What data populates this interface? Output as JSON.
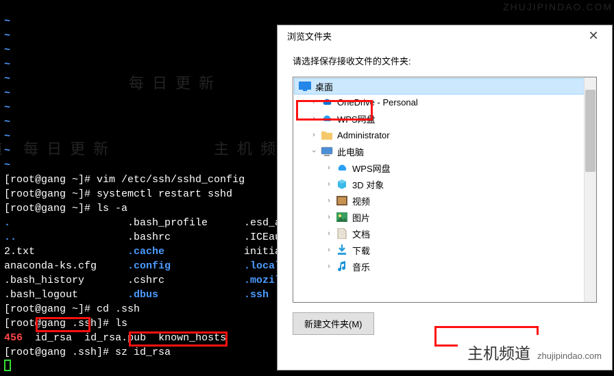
{
  "terminal": {
    "tilde": "~",
    "l1_a": "[root@gang ~]# ",
    "l1_b": "vim /etc/ssh/sshd_config",
    "l2_a": "[root@gang ~]# ",
    "l2_b": "systemctl restart sshd",
    "l3_a": "[root@gang ~]# ",
    "l3_b": "ls -a",
    "row1": {
      "c1": ".",
      "c2": ".bash_profile",
      "c3": ".esd_auth"
    },
    "row2": {
      "c1": "..",
      "c2": ".bashrc",
      "c3": ".ICEauthority"
    },
    "row3": {
      "c1": "2.txt",
      "c2": ".cache",
      "c3": "initial-setup-ks.cfg"
    },
    "row4": {
      "c1": "anaconda-ks.cfg",
      "c2": ".config",
      "c3": ".local"
    },
    "row5": {
      "c1": ".bash_history",
      "c2": ".cshrc",
      "c3": ".mozilla"
    },
    "row6": {
      "c1": ".bash_logout",
      "c2": ".dbus",
      "c3": ".ssh"
    },
    "l4_a": "[root@gang ~]# ",
    "l4_b": "cd .ssh",
    "l5_a": "[root@gang .ssh]# ",
    "l5_b": "ls",
    "lsrow": {
      "a": "456",
      "b": "id_rsa",
      "c": "id_rsa.pub",
      "d": "known_hosts"
    },
    "l6_a": "[root@gang .ssh]# ",
    "l6_b": "sz id_rsa"
  },
  "watermarks": {
    "cn1": "每日更新",
    "cn2": "主机频道 每日更新",
    "cn3": "主机频道",
    "en1": "ZHUJIPINDAO.COM",
    "en2": "ZHUJIPIND"
  },
  "dialog": {
    "title": "浏览文件夹",
    "message": "请选择保存接收文件的文件夹:",
    "tree": {
      "desktop": "桌面",
      "onedrive": "OneDrive - Personal",
      "wps": "WPS网盘",
      "admin": "Administrator",
      "thispc": "此电脑",
      "wps2": "WPS网盘",
      "threeD": "3D 对象",
      "video": "视频",
      "pictures": "图片",
      "docs": "文档",
      "downloads": "下载",
      "music": "音乐"
    },
    "newfolder": "新建文件夹(M)"
  },
  "brand": {
    "cn": "主机频道",
    "en": "zhujipindao.com"
  }
}
